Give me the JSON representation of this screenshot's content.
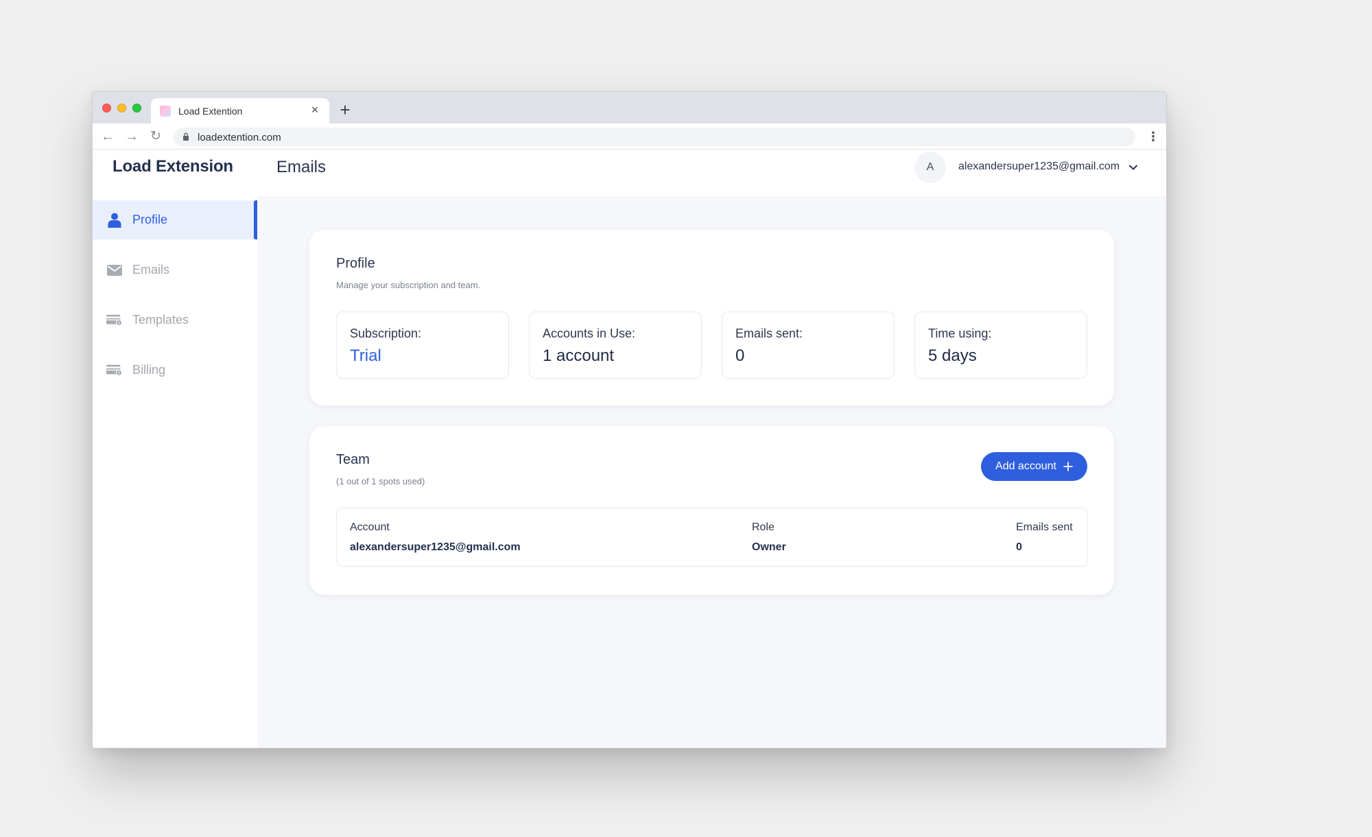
{
  "browser": {
    "tab_title": "Load Extention",
    "tab_close": "×",
    "new_tab": "+",
    "url": "loadextention.com",
    "back": "←",
    "forward": "→",
    "reload": "↻",
    "menu": "⋮"
  },
  "app": {
    "brand": "Load Extension",
    "page_title": "Emails",
    "user": {
      "avatar_initial": "A",
      "email": "alexandersuper1235@gmail.com"
    }
  },
  "sidebar": {
    "items": [
      {
        "label": "Profile",
        "icon": "user-icon",
        "active": true
      },
      {
        "label": "Emails",
        "icon": "mail-icon",
        "active": false
      },
      {
        "label": "Templates",
        "icon": "card-icon",
        "active": false
      },
      {
        "label": "Billing",
        "icon": "card-icon",
        "active": false
      }
    ]
  },
  "profile": {
    "title": "Profile",
    "subtitle": "Manage your subscription and team.",
    "stats": [
      {
        "label": "Subscription:",
        "value": "Trial"
      },
      {
        "label": "Accounts in Use:",
        "value": "1 account"
      },
      {
        "label": "Emails sent:",
        "value": "0"
      },
      {
        "label": "Time using:",
        "value": "5 days"
      }
    ]
  },
  "team": {
    "title": "Team",
    "subtitle": "(1 out of 1 spots used)",
    "add_button": "Add account",
    "columns": [
      "Account",
      "Role",
      "Emails sent"
    ],
    "rows": [
      [
        "alexandersuper1235@gmail.com",
        "Owner",
        "0"
      ]
    ]
  },
  "colors": {
    "accent": "#2f5fde",
    "active_bg": "#e9f0fb",
    "text": "#2b3450",
    "muted": "#a3a6ad",
    "page_bg": "#f5f7fb"
  }
}
